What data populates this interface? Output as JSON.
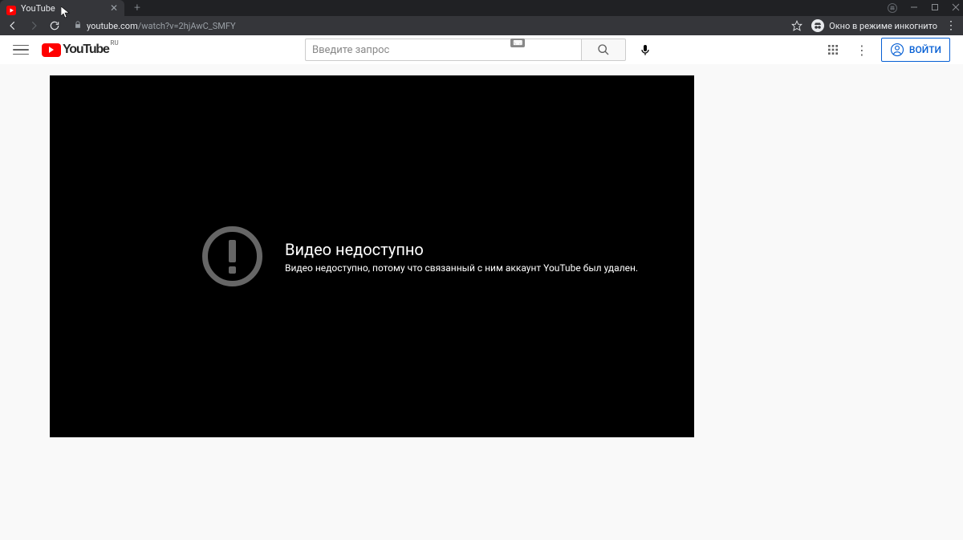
{
  "browser": {
    "tab_title": "YouTube",
    "url_host": "youtube.com",
    "url_path": "/watch?v=2hjAwC_SMFY",
    "incognito_label": "Окно в режиме инкогнито"
  },
  "youtube": {
    "logo_text": "YouTube",
    "logo_cc": "RU",
    "search_placeholder": "Введите запрос",
    "signin_label": "ВОЙТИ"
  },
  "player_error": {
    "title": "Видео недоступно",
    "detail": "Видео недоступно, потому что связанный с ним аккаунт YouTube был удален."
  }
}
